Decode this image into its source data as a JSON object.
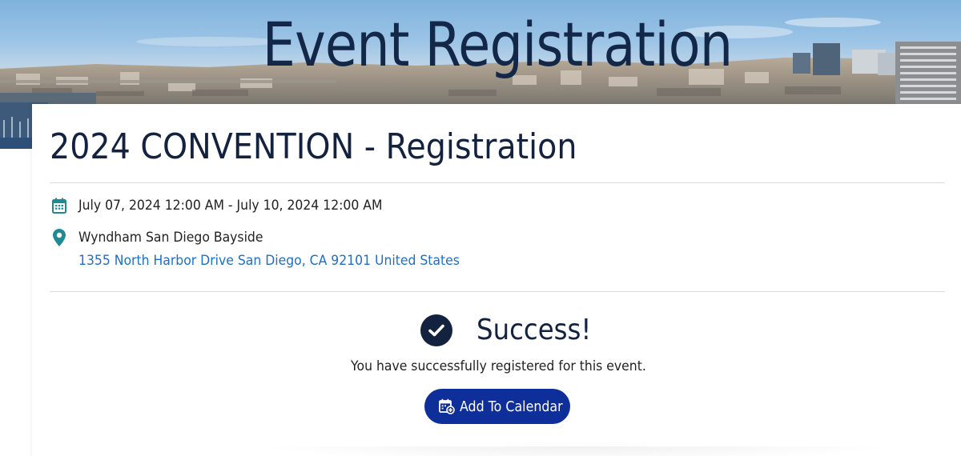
{
  "banner": {
    "title": "Event Registration"
  },
  "event": {
    "title": "2024 CONVENTION - Registration",
    "date_range": "July 07, 2024 12:00 AM - July 10, 2024 12:00 AM",
    "venue": "Wyndham San Diego Bayside",
    "address": "1355 North Harbor Drive San Diego, CA 92101 United States"
  },
  "confirmation": {
    "heading": "Success!",
    "message": "You have successfully registered for this event.",
    "calendar_button_label": "Add To Calendar"
  },
  "icons": {
    "date": "calendar-icon",
    "location": "map-pin-icon",
    "success": "check-circle-icon",
    "calendar_button": "calendar-add-icon"
  },
  "colors": {
    "navy": "#13233f",
    "accent_teal": "#1f8a94",
    "link_blue": "#1e6fc8",
    "button_blue": "#0e2f9a"
  }
}
